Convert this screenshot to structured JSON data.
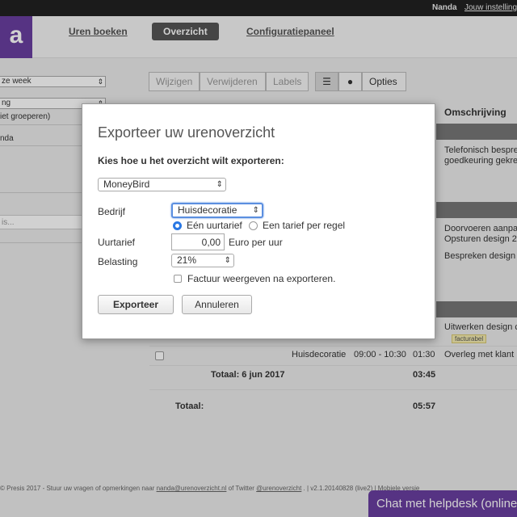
{
  "topbar": {
    "user": "Nanda",
    "settings_link": "Jouw instellingen"
  },
  "header": {
    "logo_letter": "a",
    "nav": [
      {
        "label": "Uren boeken"
      },
      {
        "label": "Overzicht"
      },
      {
        "label": "Configuratiepaneel"
      }
    ]
  },
  "sidebar": {
    "period_select": "ze week",
    "group_select": "ng",
    "group_option": "iet groeperen)",
    "user_select": "nda",
    "search_placeholder": "is..."
  },
  "toolbar": {
    "edit": "Wijzigen",
    "delete": "Verwijderen",
    "labels": "Labels",
    "options": "Opties"
  },
  "table": {
    "col_description": "Omschrijving",
    "rows": [
      {
        "desc1": "Telefonisch bespre",
        "desc2": "goedkeuring gekre"
      },
      {
        "desc1": "Doorvoeren aanpa",
        "desc2": "Opsturen design 2"
      },
      {
        "desc1": "Bespreken design"
      },
      {
        "desc1": "Uitwerken design c",
        "badge": "facturabel"
      },
      {
        "company": "Huisdecoratie",
        "time": "09:00 - 10:30",
        "duration": "01:30",
        "desc1": "Overleg met klant"
      }
    ],
    "day_total_label": "Totaal: 6 jun 2017",
    "day_total_value": "03:45",
    "total_label": "Totaal:",
    "total_value": "05:57"
  },
  "footer": {
    "text_prefix": "© Presis 2017 - Stuur uw vragen of opmerkingen naar ",
    "email": "nanda@urenoverzicht.nl",
    "text_mid": " of Twitter ",
    "twitter": "@urenoverzicht",
    "text_suffix": " . | v2.1.20140828 (live2) | Mobiele versie"
  },
  "chat": {
    "label": "Chat met helpdesk (online)"
  },
  "modal": {
    "title": "Exporteer uw urenoverzicht",
    "subtitle": "Kies hoe u het overzicht wilt exporteren:",
    "export_select": "MoneyBird",
    "company_label": "Bedrijf",
    "company_select": "Huisdecoratie",
    "radio_single": "Eén uurtarief",
    "radio_per_line": "Een tarief per regel",
    "rate_label": "Uurtarief",
    "rate_value": "0,00",
    "rate_unit": "Euro per uur",
    "tax_label": "Belasting",
    "tax_select": "21%",
    "invoice_checkbox": "Factuur weergeven na exporteren.",
    "export_button": "Exporteer",
    "cancel_button": "Annuleren"
  }
}
